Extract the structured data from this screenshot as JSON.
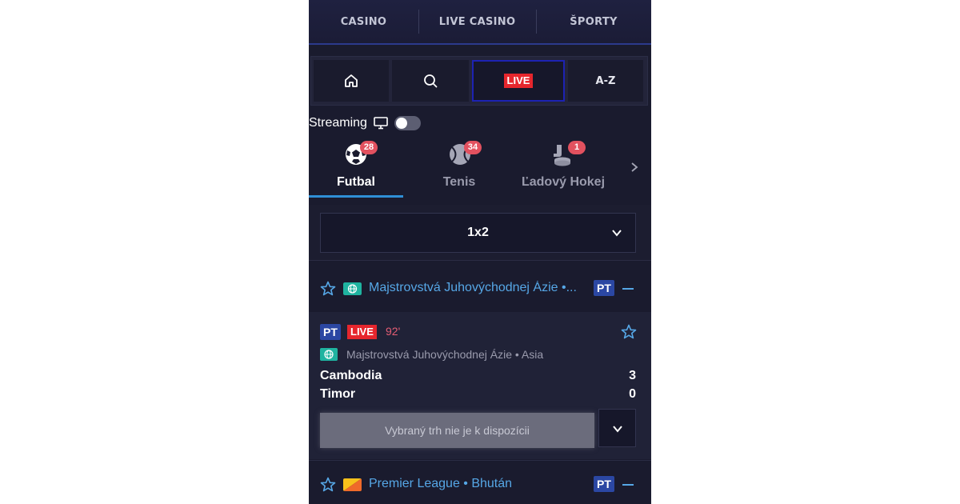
{
  "topnav": {
    "items": [
      "CASINO",
      "LIVE CASINO",
      "ŠPORTY"
    ]
  },
  "quickbar": {
    "home_icon": "home-icon",
    "search_icon": "search-icon",
    "live_label": "LIVE",
    "az_label": "A-Z"
  },
  "streaming": {
    "label": "Streaming",
    "icon": "monitor-icon",
    "enabled": false
  },
  "sports": [
    {
      "name": "Futbal",
      "count": "28",
      "icon": "football-icon",
      "active": true
    },
    {
      "name": "Tenis",
      "count": "34",
      "icon": "tennis-ball-icon",
      "active": false
    },
    {
      "name": "Ľadový Hokej",
      "count": "1",
      "icon": "ice-hockey-icon",
      "active": false
    }
  ],
  "market": {
    "value": "1x2"
  },
  "leagues": [
    {
      "name": "Majstrovstvá Juhovýchodnej Ázie •...",
      "badge": "PT",
      "flag": "globe-icon"
    },
    {
      "name": "Premier League • Bhután",
      "badge": "PT",
      "flag": "bhutan-flag-icon"
    }
  ],
  "match": {
    "badge": "PT",
    "live": "LIVE",
    "minute": "92'",
    "competition": "Majstrovstvá Juhovýchodnej Ázie • Asia",
    "home_team": "Cambodia",
    "away_team": "Timor",
    "home_score": "3",
    "away_score": "0",
    "unavailable": "Vybraný trh nie je k dispozícii"
  },
  "colors": {
    "accent": "#56a7e6",
    "live": "#e6262d",
    "badge": "#e2515f",
    "pt": "#2b47a3",
    "background": "#1a1b2e"
  }
}
